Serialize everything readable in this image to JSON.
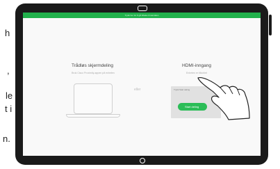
{
  "background_text": [
    "h",
    ",",
    "le",
    "t i",
    "n."
  ],
  "status_bar": {
    "text": "Trykk her for å gå tilbake til samtalen"
  },
  "wireless": {
    "title": "Trådløs skjermdeling",
    "subtitle": "Bruk Cisco Proximity-appen på enheten"
  },
  "divider": {
    "text": "eller"
  },
  "hdmi": {
    "title": "HDMI-inngang",
    "subtitle": "Enheten er tilkoblet",
    "card_caption": "Trykk Start deling",
    "start_button": "Start deling"
  },
  "colors": {
    "accent_green": "#22b14c",
    "bezel": "#1a1a1a",
    "screen_bg": "#f9f9f9"
  },
  "icons": [
    "laptop-icon",
    "pointing-hand-icon",
    "home-button-icon",
    "camera-notch-icon"
  ]
}
